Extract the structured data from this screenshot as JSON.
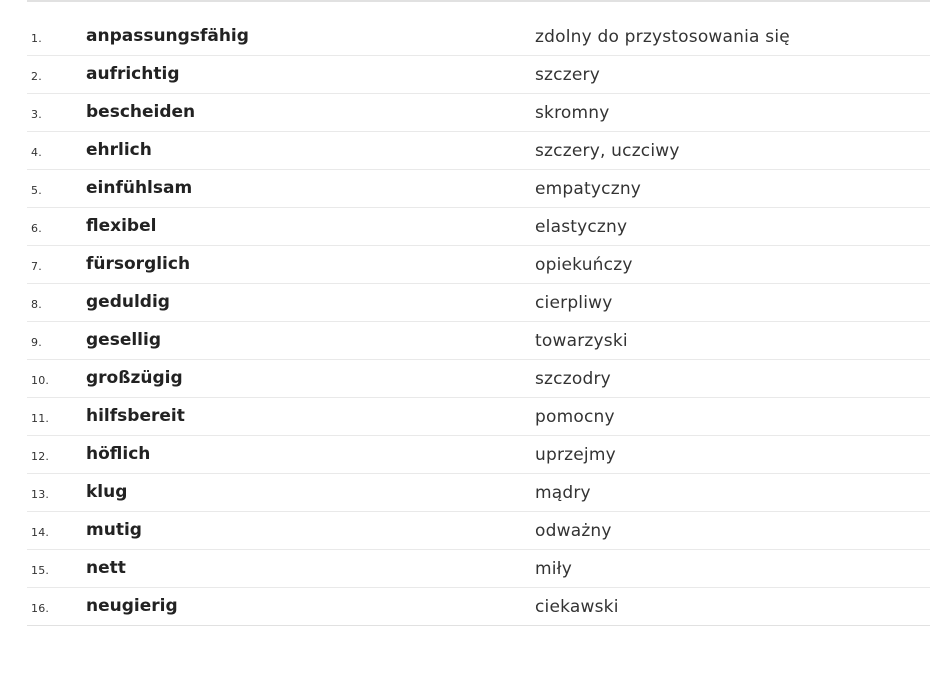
{
  "vocabulary": [
    {
      "number": "1.",
      "german": "anpassungsfähig",
      "polish": "zdolny do przystosowania się"
    },
    {
      "number": "2.",
      "german": "aufrichtig",
      "polish": "szczery"
    },
    {
      "number": "3.",
      "german": "bescheiden",
      "polish": "skromny"
    },
    {
      "number": "4.",
      "german": "ehrlich",
      "polish": "szczery, uczciwy"
    },
    {
      "number": "5.",
      "german": "einfühlsam",
      "polish": "empatyczny"
    },
    {
      "number": "6.",
      "german": "flexibel",
      "polish": "elastyczny"
    },
    {
      "number": "7.",
      "german": "fürsorglich",
      "polish": "opiekuńczy"
    },
    {
      "number": "8.",
      "german": "geduldig",
      "polish": "cierpliwy"
    },
    {
      "number": "9.",
      "german": "gesellig",
      "polish": "towarzyski"
    },
    {
      "number": "10.",
      "german": "großzügig",
      "polish": "szczodry"
    },
    {
      "number": "11.",
      "german": "hilfsbereit",
      "polish": "pomocny"
    },
    {
      "number": "12.",
      "german": "höflich",
      "polish": "uprzejmy"
    },
    {
      "number": "13.",
      "german": "klug",
      "polish": "mądry"
    },
    {
      "number": "14.",
      "german": "mutig",
      "polish": "odważny"
    },
    {
      "number": "15.",
      "german": "nett",
      "polish": "miły"
    },
    {
      "number": "16.",
      "german": "neugierig",
      "polish": "ciekawski"
    }
  ]
}
